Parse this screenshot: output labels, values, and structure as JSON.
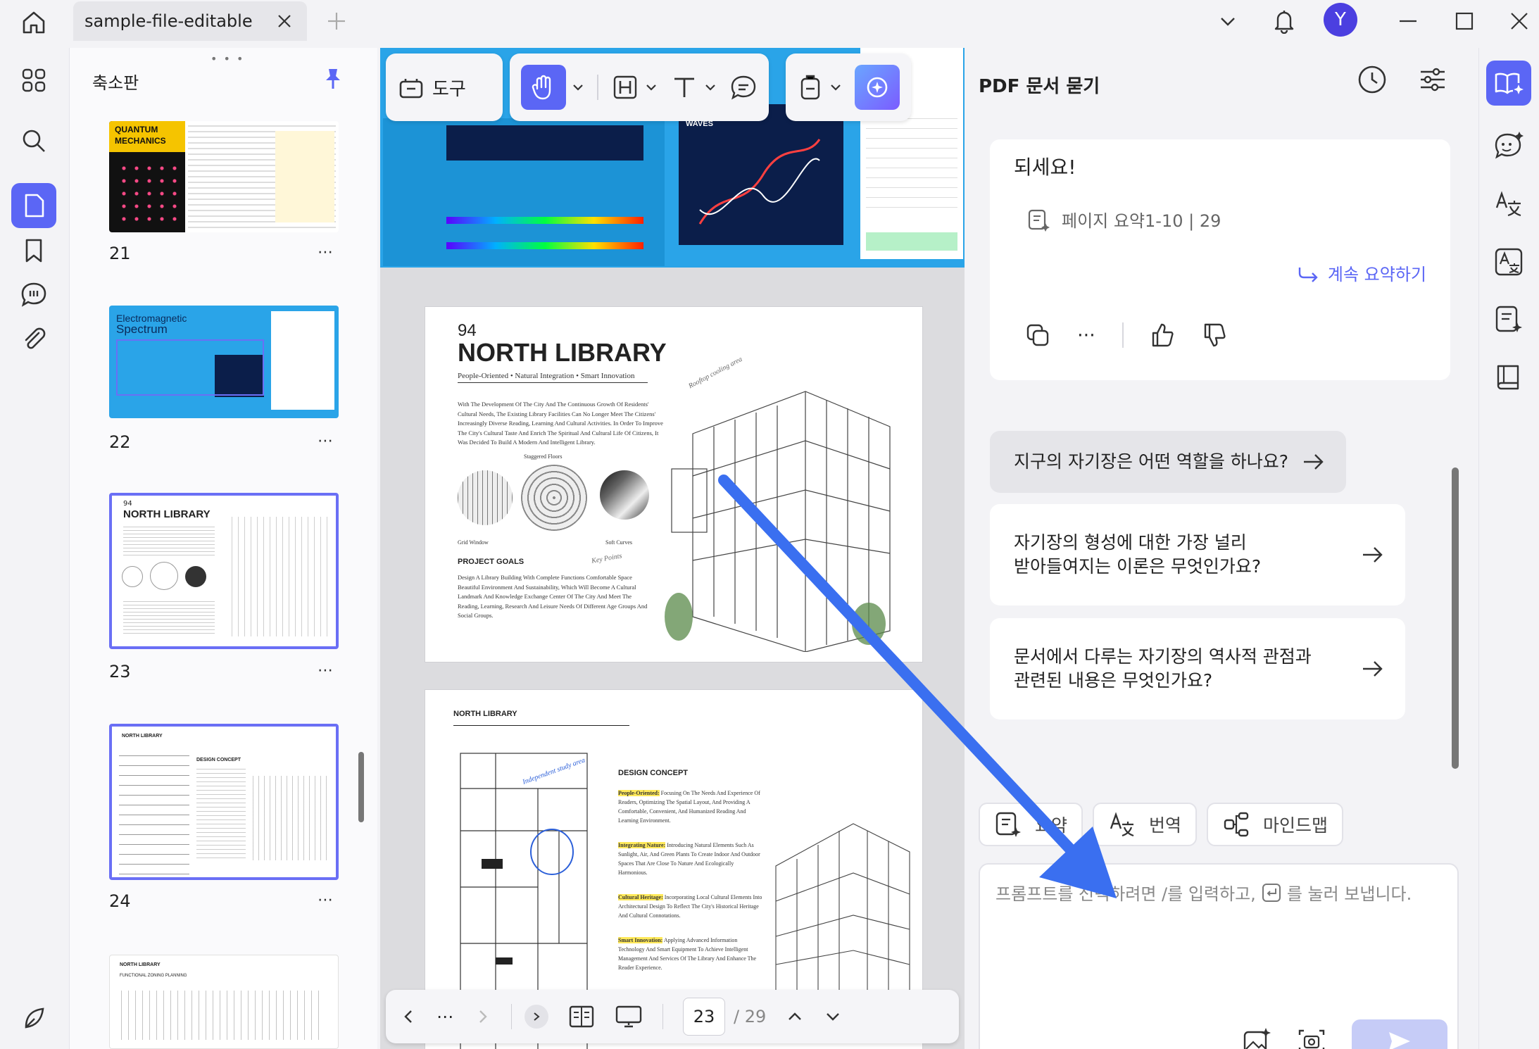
{
  "window": {
    "tab_title": "sample-file-editable",
    "avatar_letter": "Y",
    "accent": "#5b66f5"
  },
  "thumbs": {
    "header": "축소판",
    "pages": [
      {
        "number": "21",
        "label_top": "QUANTUM",
        "label_bottom": "MECHANICS"
      },
      {
        "number": "22",
        "label_top": "Electromagnetic",
        "label_bottom": "Spectrum"
      },
      {
        "number": "23",
        "label_top": "94",
        "label_bottom": "NORTH LIBRARY"
      },
      {
        "number": "24",
        "label_top": "NORTH LIBRARY",
        "label_bottom": "DESIGN CONCEPT"
      },
      {
        "number": "25",
        "label_top": "NORTH LIBRARY",
        "label_bottom": "FUNCTIONAL ZONING PLANNING"
      }
    ],
    "more_glyph": "⋯"
  },
  "toolbar": {
    "tools_label": "도구"
  },
  "doc": {
    "top_page": {
      "spectrum_title": "ELECTROMAGNETIC WAVES"
    },
    "page23": {
      "page_no": "94",
      "title": "NORTH LIBRARY",
      "subtitle": "People-Oriented • Natural Integration • Smart Innovation",
      "intro": "With The Development Of The City And The Continuous Growth Of Residents' Cultural Needs, The Existing Library Facilities Can No Longer Meet The Citizens' Increasingly Diverse Reading, Learning And Cultural Activities. In Order To Improve The City's Cultural Taste And Enrich The Spiritual And Cultural Life Of Citizens, It Was Decided To Build A Modern And Intelligent Library.",
      "label_staggered": "Staggered Floors",
      "label_grid": "Grid Window",
      "label_soft": "Soft Curves",
      "goals_title": "PROJECT GOALS",
      "goals_text": "Design A Library Building With Complete Functions Comfortable Space Beautiful Environment And Sustainability, Which Will Become A Cultural Landmark And Knowledge Exchange Center Of The City And Meet The Reading, Learning, Research And Leisure Needs Of Different Age Groups And Social Groups.",
      "handwritten_roof": "Rooftop cooling area",
      "handwritten_key": "Key Points"
    },
    "page24": {
      "header": "NORTH LIBRARY",
      "concept_title": "DESIGN CONCEPT",
      "p1_key": "People-Oriented:",
      "p1": "Focusing On The Needs And Experience Of Readers, Optimizing The Spatial Layout, And Providing A Comfortable, Convenient, And Humanized Reading And Learning Environment.",
      "p2_key": "Integrating Nature:",
      "p2": "Introducing Natural Elements Such As Sunlight, Air, And Green Plants To Create Indoor And Outdoor Spaces That Are Close To Nature And Ecologically Harmonious.",
      "p3_key": "Cultural Heritage:",
      "p3": "Incorporating Local Cultural Elements Into Architectural Design To Reflect The City's Historical Heritage And Cultural Connotations.",
      "p4_key": "Smart Innovation:",
      "p4": "Applying Advanced Information Technology And Smart Equipment To Achieve Intelligent Management And Services Of The Library And Enhance The Reader Experience.",
      "handwritten": "Independent study area"
    }
  },
  "pager": {
    "current": "23",
    "total": "/ 29"
  },
  "ai": {
    "title": "PDF 문서 묻기",
    "message_text": "되세요!",
    "ref": "페이지 요약1-10 | 29",
    "continue": "계속 요약하기",
    "suggestions": [
      {
        "line1": "지구의 자기장은 어떤 역할을 하나요?",
        "line2": ""
      },
      {
        "line1": "자기장의 형성에 대한 가장 널리",
        "line2": "받아들여지는 이론은 무엇인가요?"
      },
      {
        "line1": "문서에서 다루는 자기장의 역사적 관점과",
        "line2": "관련된 내용은 무엇인가요?"
      }
    ],
    "chips": {
      "summary": "요약",
      "translate": "번역",
      "mindmap": "마인드맵"
    },
    "input_placeholder_a": "프롬프트를 선택하려면 /를 입력하고,",
    "input_placeholder_b": "를 눌러 보냅니다."
  }
}
